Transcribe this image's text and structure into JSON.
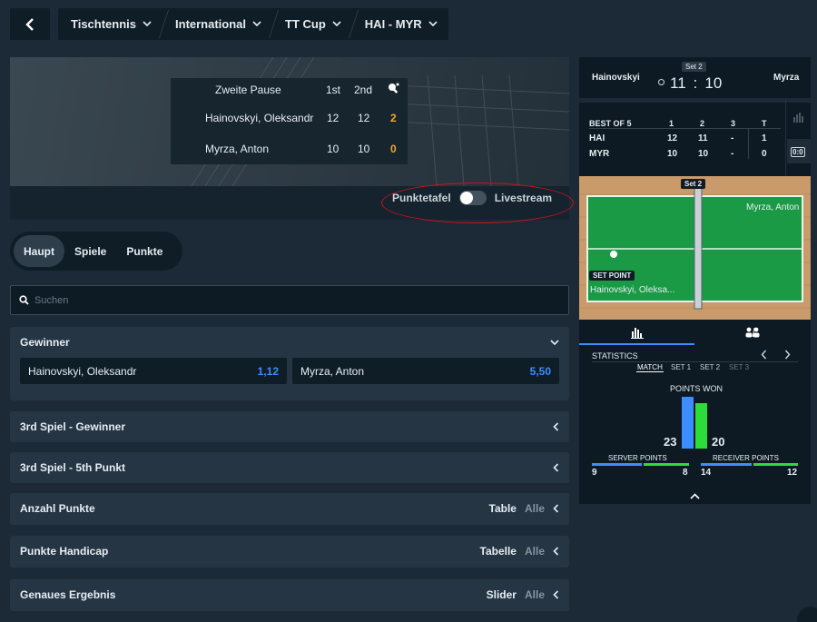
{
  "nav": {
    "back_icon": "chevron-left-icon",
    "breadcrumbs": [
      {
        "label": "Tischtennis"
      },
      {
        "label": "International"
      },
      {
        "label": "TT Cup"
      },
      {
        "label": "HAI - MYR"
      }
    ]
  },
  "scoreboard": {
    "status": "Zweite Pause",
    "col_1": "1st",
    "col_2": "2nd",
    "players": [
      {
        "name": "Hainovskyi, Oleksandr",
        "s1": "12",
        "s2": "12",
        "total": "2"
      },
      {
        "name": "Myrza, Anton",
        "s1": "10",
        "s2": "10",
        "total": "0"
      }
    ],
    "toggle_left": "Punktetafel",
    "toggle_right": "Livestream"
  },
  "tabs": [
    {
      "label": "Haupt"
    },
    {
      "label": "Spiele"
    },
    {
      "label": "Punkte"
    }
  ],
  "search": {
    "placeholder": "Suchen"
  },
  "markets": {
    "winner": {
      "title": "Gewinner",
      "odds": [
        {
          "name": "Hainovskyi, Oleksandr",
          "price": "1,12"
        },
        {
          "name": "Myrza, Anton",
          "price": "5,50"
        }
      ]
    },
    "list": [
      {
        "title": "3rd Spiel - Gewinner",
        "view": "",
        "alle": ""
      },
      {
        "title": "3rd Spiel - 5th Punkt",
        "view": "",
        "alle": ""
      },
      {
        "title": "Anzahl Punkte",
        "view": "Table",
        "alle": "Alle"
      },
      {
        "title": "Punkte Handicap",
        "view": "Tabelle",
        "alle": "Alle"
      },
      {
        "title": "Genaues Ergebnis",
        "view": "Slider",
        "alle": "Alle"
      }
    ]
  },
  "live": {
    "home": "Hainovskyi",
    "away": "Myrza",
    "set_label": "Set 2",
    "score_home": "11",
    "score_sep": ":",
    "score_away": "10",
    "table": {
      "header": [
        "BEST OF 5",
        "1",
        "2",
        "3",
        "T"
      ],
      "rows": [
        [
          "HAI",
          "12",
          "11",
          "-",
          "1"
        ],
        [
          "MYR",
          "10",
          "10",
          "-",
          "0"
        ]
      ]
    },
    "court": {
      "set_label": "Set 2",
      "top_player": "Myrza, Anton",
      "badge": "SET POINT",
      "bottom_player": "Hainovskyi, Oleksa..."
    },
    "scoreboard_icon_text": "0:0"
  },
  "stats": {
    "title": "STATISTICS",
    "filters": [
      "MATCH",
      "SET 1",
      "SET 2",
      "SET 3"
    ],
    "points_won_label": "POINTS WON",
    "points_home": "23",
    "points_away": "20",
    "points_home_value": 23,
    "points_away_value": 20,
    "server_label": "SERVER POINTS",
    "receiver_label": "RECEIVER POINTS",
    "server_home": "9",
    "server_away": "8",
    "receiver_home": "14",
    "receiver_away": "12"
  },
  "colors": {
    "accent_blue": "#3c8dff",
    "accent_green": "#2bdc3a",
    "highlight_orange": "#f5a623",
    "annotation_red": "#d0111b"
  }
}
